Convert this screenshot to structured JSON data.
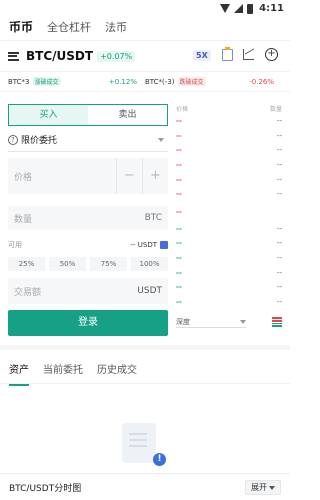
{
  "status_bar": {
    "time": "4:11"
  },
  "top_nav": {
    "tabs": [
      "币币",
      "全仓杠杆",
      "法币"
    ]
  },
  "pair_bar": {
    "pair": "BTC/USDT",
    "change": "+0.07%",
    "leverage": "5X"
  },
  "tickers": [
    {
      "name": "BTC*3",
      "tag": "涨破成交",
      "change": "+0.12%",
      "trend": "up"
    },
    {
      "name": "BTC*(-3)",
      "tag": "跌破成交",
      "change": "-0.26%",
      "trend": "down"
    }
  ],
  "trade_form": {
    "buy_label": "买入",
    "sell_label": "卖出",
    "order_type": "限价委托",
    "price_placeholder": "价格",
    "price_minus": "−",
    "price_plus": "+",
    "qty_placeholder": "数量",
    "qty_unit": "BTC",
    "available_label": "可用",
    "available_value": "-- USDT",
    "percent_options": [
      "25%",
      "50%",
      "75%",
      "100%"
    ],
    "total_placeholder": "交易额",
    "total_unit": "USDT",
    "submit_label": "登录"
  },
  "order_book": {
    "price_header": "价格",
    "qty_header": "数量",
    "asks": [
      "--",
      "--",
      "--",
      "--",
      "--",
      "--"
    ],
    "mid_price": "--",
    "bids": [
      "--",
      "--",
      "--",
      "--",
      "--",
      "--"
    ],
    "depth_label": "深度"
  },
  "bottom_tabs": [
    "资产",
    "当前委托",
    "历史成交"
  ],
  "footer": {
    "title": "BTC/USDT分时图",
    "expand_label": "展开"
  },
  "colors": {
    "green": "#16a085",
    "red": "#e0464e",
    "blue": "#3b6fe0"
  }
}
